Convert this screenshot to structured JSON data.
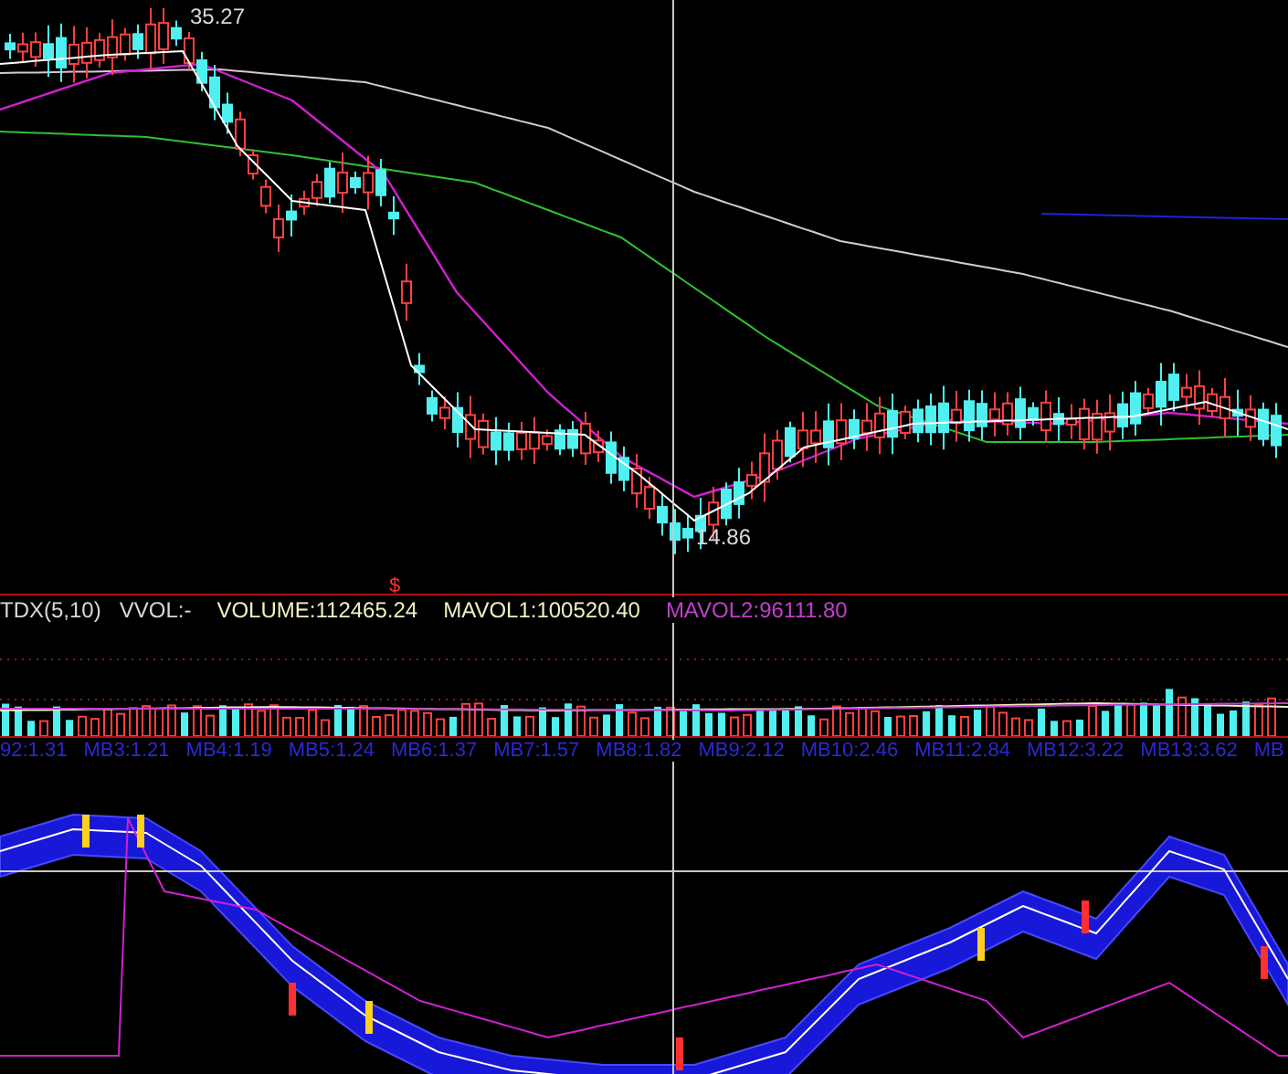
{
  "price_panel": {
    "high_label": "35.27",
    "low_label": "14.86",
    "marker": "$"
  },
  "indicator_header": [
    {
      "text": "TDX(5,10)",
      "kind": "name",
      "color": "#d8d8d8"
    },
    {
      "text": "VVOL:-",
      "kind": "name",
      "color": "#d8d8d8"
    },
    {
      "text": "VOLUME:112465.24",
      "kind": "value",
      "color": "#f0f0c0"
    },
    {
      "text": "MAVOL1:100520.40",
      "kind": "value",
      "color": "#f0f0c0"
    },
    {
      "text": "MAVOL2:96111.80",
      "kind": "value",
      "color": "#c040c8"
    }
  ],
  "mb_labels": [
    "92:1.31",
    "MB3:1.21",
    "MB4:1.19",
    "MB5:1.24",
    "MB6:1.37",
    "MB7:1.57",
    "MB8:1.82",
    "MB9:2.12",
    "MB10:2.46",
    "MB11:2.84",
    "MB12:3.22",
    "MB13:3.62",
    "MB"
  ]
}
